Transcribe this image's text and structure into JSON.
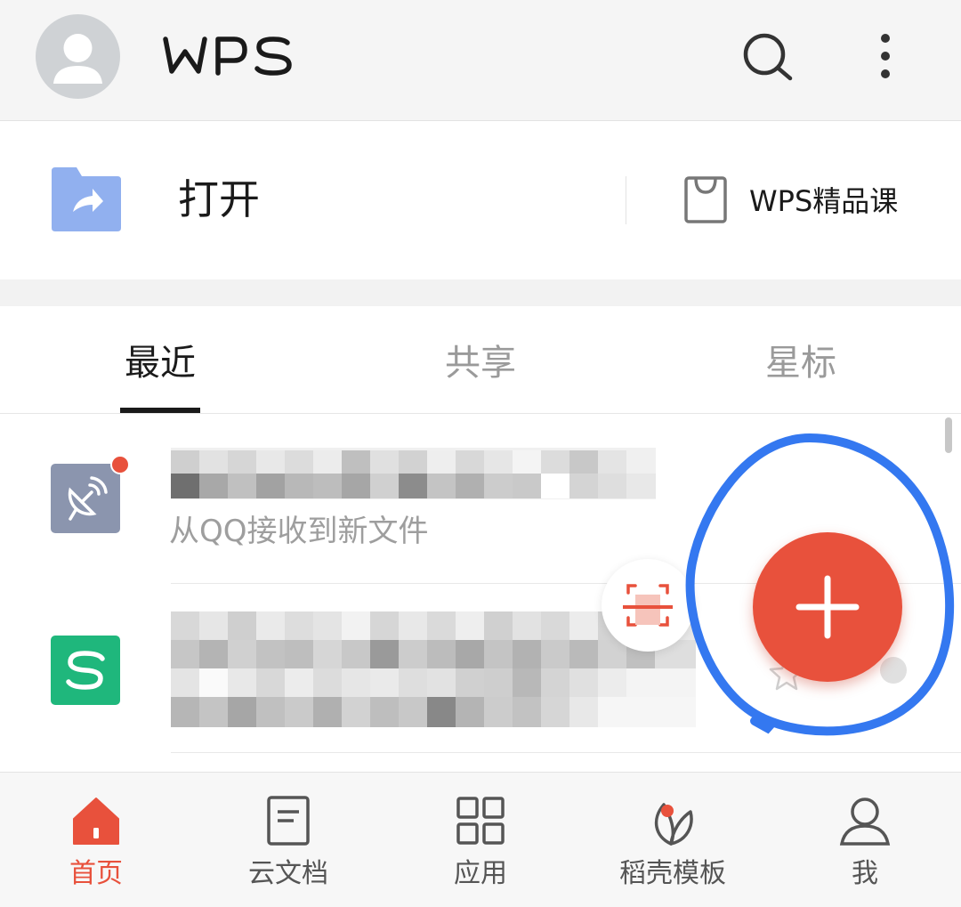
{
  "header": {
    "logo_text": "WPS",
    "icons": {
      "avatar": "avatar-icon",
      "search": "search-icon",
      "more": "more-vertical-icon"
    }
  },
  "open_row": {
    "open_label": "打开",
    "open_icon": "folder-open-icon",
    "course_label": "WPS精品课",
    "course_icon": "shopping-bag-icon"
  },
  "tabs": [
    {
      "label": "最近",
      "active": true
    },
    {
      "label": "共享",
      "active": false
    },
    {
      "label": "星标",
      "active": false
    }
  ],
  "files": [
    {
      "name_obscured": true,
      "subtitle": "从QQ接收到新文件",
      "icon": "satellite-dish-icon",
      "icon_color": "#8b95ae",
      "unread": true
    },
    {
      "name_obscured": true,
      "subtitle": "",
      "icon": "wps-sheet-icon",
      "icon_color": "#1fb77c",
      "unread": false
    }
  ],
  "fab": {
    "icon": "plus-icon",
    "color": "#e8513c",
    "scan_icon": "scan-document-icon"
  },
  "bottom_nav": [
    {
      "label": "首页",
      "icon": "home-icon",
      "active": true
    },
    {
      "label": "云文档",
      "icon": "document-icon",
      "active": false
    },
    {
      "label": "应用",
      "icon": "apps-grid-icon",
      "active": false
    },
    {
      "label": "稻壳模板",
      "icon": "leaf-icon",
      "active": false,
      "badge": true
    },
    {
      "label": "我",
      "icon": "user-icon",
      "active": false
    }
  ],
  "colors": {
    "accent": "#e8513c",
    "annotation": "#3478f0",
    "text": "#1a1a1a",
    "muted": "#9a9a9a"
  }
}
